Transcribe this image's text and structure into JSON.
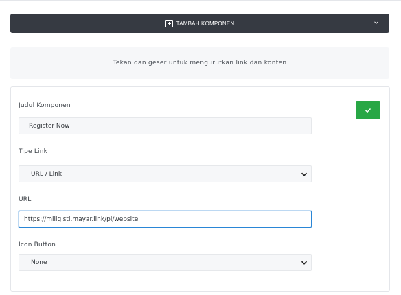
{
  "toolbar": {
    "add_component_label": "TAMBAH KOMPONEN",
    "add_icon": "plus-square-icon",
    "expand_icon": "chevron-down-icon"
  },
  "info": {
    "text": "Tekan dan geser untuk mengurutkan link dan konten"
  },
  "form": {
    "title_label": "Judul Komponen",
    "title_value": "Register Now",
    "link_type_label": "Tipe Link",
    "link_type_value": "URL / Link",
    "url_label": "URL",
    "url_value": "https://miligisti.mayar.link/pl/website",
    "icon_button_label": "Icon Button",
    "icon_button_value": "None",
    "confirm_icon": "check-icon"
  },
  "colors": {
    "toolbar_bg": "#363a42",
    "confirm_bg": "#28a745",
    "focus_border": "#2a86d6"
  }
}
